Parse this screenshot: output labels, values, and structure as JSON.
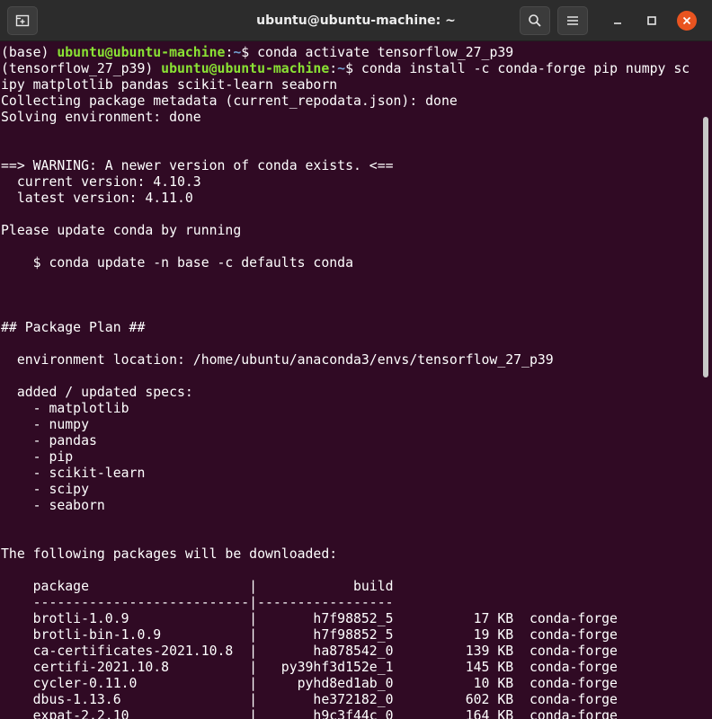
{
  "window": {
    "title": "ubuntu@ubuntu-machine: ~",
    "icons": {
      "new_tab": "new-tab-icon",
      "search": "search-icon",
      "menu": "hamburger-menu-icon",
      "minimize": "minimize-icon",
      "maximize": "maximize-icon",
      "close": "close-icon"
    },
    "colors": {
      "background": "#300a24",
      "user": "#8ae234",
      "path": "#729fcf",
      "close": "#e95420"
    }
  },
  "terminal": {
    "prompt1": {
      "env": "(base) ",
      "user": "ubuntu@ubuntu-machine",
      "colon": ":",
      "path": "~",
      "cmd": "$ conda activate tensorflow_27_p39"
    },
    "prompt2": {
      "env": "(tensorflow_27_p39) ",
      "user": "ubuntu@ubuntu-machine",
      "colon": ":",
      "path": "~",
      "cmd": "$ conda install -c conda-forge pip numpy sc"
    },
    "lines": [
      "ipy matplotlib pandas scikit-learn seaborn",
      "Collecting package metadata (current_repodata.json): done",
      "Solving environment: done",
      "",
      "",
      "==> WARNING: A newer version of conda exists. <==",
      "  current version: 4.10.3",
      "  latest version: 4.11.0",
      "",
      "Please update conda by running",
      "",
      "    $ conda update -n base -c defaults conda",
      "",
      "",
      "",
      "## Package Plan ##",
      "",
      "  environment location: /home/ubuntu/anaconda3/envs/tensorflow_27_p39",
      "",
      "  added / updated specs:",
      "    - matplotlib",
      "    - numpy",
      "    - pandas",
      "    - pip",
      "    - scikit-learn",
      "    - scipy",
      "    - seaborn",
      "",
      "",
      "The following packages will be downloaded:",
      "",
      "    package                    |            build",
      "    ---------------------------|-----------------",
      "    brotli-1.0.9               |       h7f98852_5          17 KB  conda-forge",
      "    brotli-bin-1.0.9           |       h7f98852_5          19 KB  conda-forge",
      "    ca-certificates-2021.10.8  |       ha878542_0         139 KB  conda-forge",
      "    certifi-2021.10.8          |   py39hf3d152e_1         145 KB  conda-forge",
      "    cycler-0.11.0              |     pyhd8ed1ab_0          10 KB  conda-forge",
      "    dbus-1.13.6                |       he372182_0         602 KB  conda-forge",
      "    expat-2.2.10               |       h9c3f44c_0         164 KB  conda-forge"
    ]
  }
}
